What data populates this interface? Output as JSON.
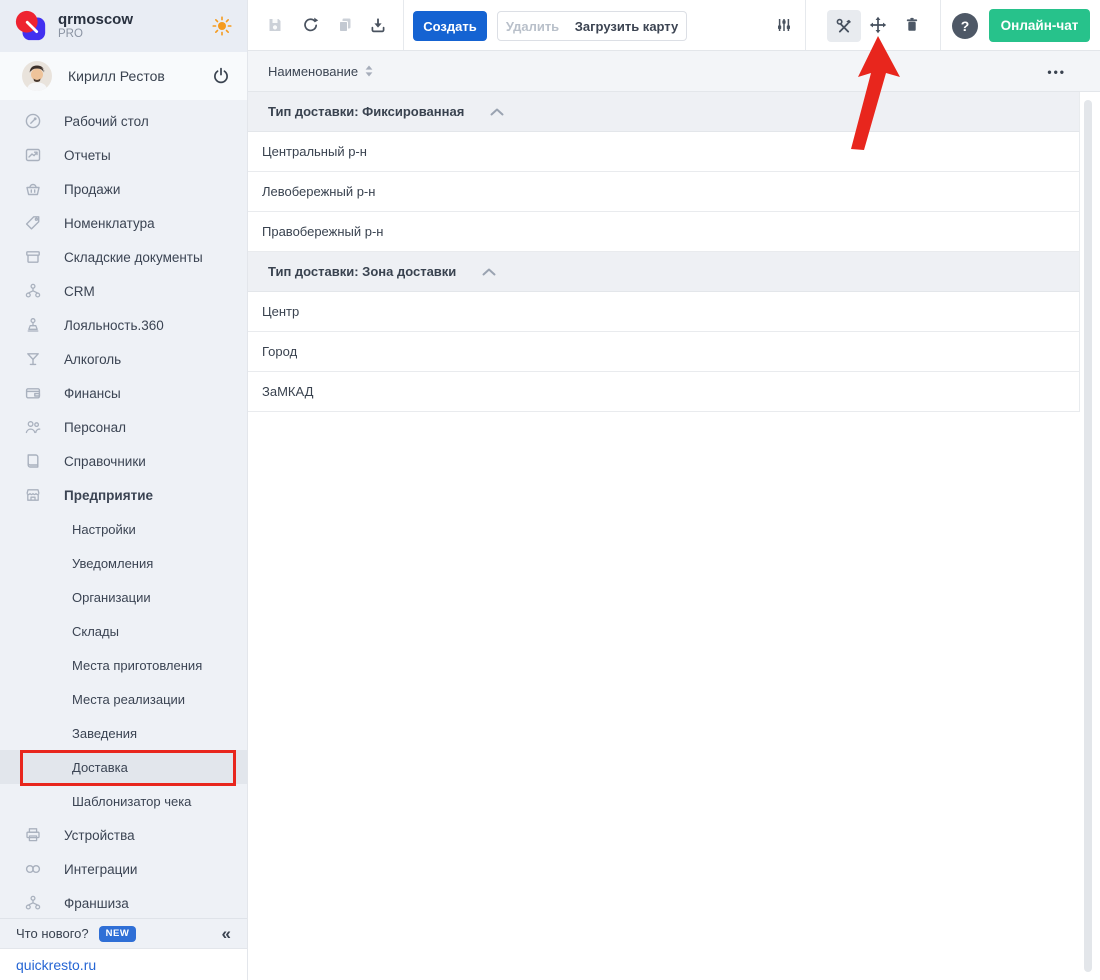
{
  "brand": {
    "name": "qrmoscow",
    "plan": "PRO"
  },
  "user": {
    "name": "Кирилл Рестов"
  },
  "toolbar": {
    "create": "Создать",
    "delete": "Удалить",
    "load_map": "Загрузить карту",
    "help": "?",
    "chat": "Онлайн-чат"
  },
  "sidebar": {
    "items": [
      "Рабочий стол",
      "Отчеты",
      "Продажи",
      "Номенклатура",
      "Складские документы",
      "CRM",
      "Лояльность.360",
      "Алкоголь",
      "Финансы",
      "Персонал",
      "Справочники",
      "Предприятие"
    ],
    "enterprise_children": [
      "Настройки",
      "Уведомления",
      "Организации",
      "Склады",
      "Места приготовления",
      "Места реализации",
      "Заведения",
      "Доставка",
      "Шаблонизатор чека"
    ],
    "items_bottom": [
      "Устройства",
      "Интеграции",
      "Франшиза"
    ],
    "whats_new": "Что нового?",
    "new_badge": "NEW",
    "collapse": "«",
    "site": "quickresto.ru"
  },
  "table": {
    "column": "Наименование",
    "menu": "•••",
    "groups": [
      {
        "label": "Тип доставки: Фиксированная",
        "rows": [
          "Центральный р-н",
          "Левобережный р-н",
          "Правобережный р-н"
        ]
      },
      {
        "label": "Тип доставки: Зона доставки",
        "rows": [
          "Центр",
          "Город",
          "ЗаМКАД"
        ]
      }
    ]
  },
  "icons": {
    "save": "save-icon",
    "refresh": "refresh-icon",
    "copy": "copy-icon",
    "download": "download-icon",
    "filter": "filter-sliders-icon",
    "tools": "tools-icon",
    "move": "move-icon",
    "trash": "trash-icon",
    "sun": "theme-sun-icon",
    "power": "logout-power-icon"
  },
  "colors": {
    "accent_blue": "#1563d2",
    "chat_green": "#27c28b",
    "annotation_red": "#e8261d",
    "badge_blue": "#2f6fd6",
    "link_blue": "#2666d4",
    "sidebar_bg": "#eef1f6",
    "group_row_bg": "#eef0f4"
  }
}
